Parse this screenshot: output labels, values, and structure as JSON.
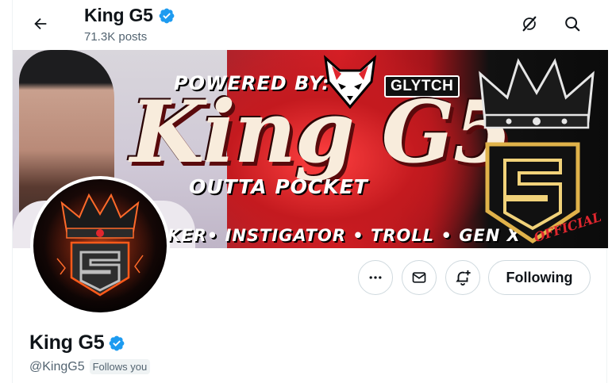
{
  "header": {
    "name": "King G5",
    "post_count": "71.3K posts",
    "back_icon": "arrow-left-icon",
    "right_icons": [
      "grok-icon",
      "search-icon"
    ]
  },
  "banner": {
    "powered_text": "POWERED BY:",
    "sponsor": "GLYTCH",
    "title": "King G5",
    "subtitle": "OUTTA POCKET",
    "tagline": "KER• INSTIGATOR • TROLL • GEN X",
    "official": "OFFICIAL"
  },
  "actions": {
    "more_icon": "more-icon",
    "message_icon": "envelope-icon",
    "notify_icon": "bell-plus-icon",
    "follow_label": "Following"
  },
  "profile": {
    "name": "King G5",
    "handle": "@KingG5",
    "follows_you": "Follows you"
  },
  "colors": {
    "verified": "#1d9bf0",
    "text": "#0f1419",
    "muted": "#536471",
    "border": "#cfd9de",
    "banner_red": "#d81f26"
  }
}
